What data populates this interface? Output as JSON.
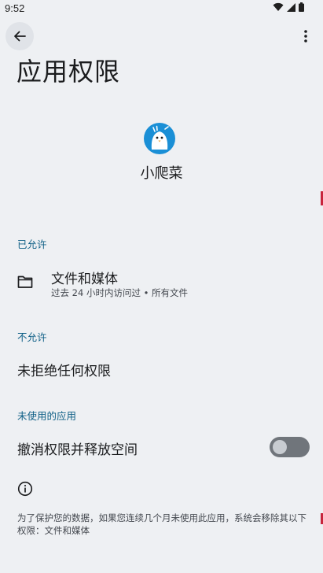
{
  "status_bar": {
    "time": "9:52",
    "icons": [
      "wifi-icon",
      "signal-icon",
      "battery-icon"
    ]
  },
  "toolbar": {
    "back_icon": "arrow-back-icon",
    "more_icon": "more-vert-icon"
  },
  "header": {
    "title": "应用权限"
  },
  "app": {
    "name": "小爬菜",
    "icon": "app-bird-icon"
  },
  "sections": {
    "allowed_header": "已允许",
    "allowed_items": [
      {
        "icon": "folder-icon",
        "title": "文件和媒体",
        "subtitle": "过去 24 小时内访问过 • 所有文件"
      }
    ],
    "denied_header": "不允许",
    "denied_empty": "未拒绝任何权限",
    "unused_header": "未使用的应用",
    "unused_toggle_label": "撤消权限并释放空间",
    "unused_toggle_on": false
  },
  "footer": {
    "icon": "info-icon",
    "text": "为了保护您的数据，如果您连续几个月未使用此应用，系统会移除其以下权限：文件和媒体"
  },
  "colors": {
    "background": "#eef0f3",
    "accent": "#0f5f86",
    "app_icon_blue": "#1a8fd6",
    "toggle_off": "#70757b"
  }
}
